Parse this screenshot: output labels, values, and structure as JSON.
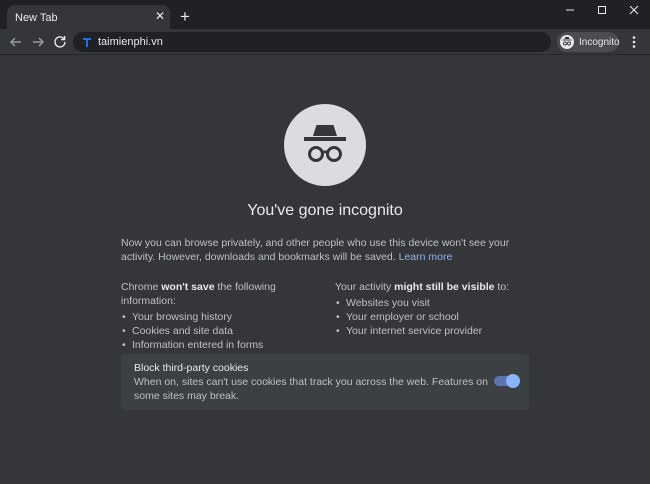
{
  "tab": {
    "title": "New Tab",
    "close_glyph": "✕"
  },
  "new_tab_glyph": "+",
  "window_controls": {
    "minimize": "—",
    "maximize": "☐",
    "close": "✕"
  },
  "toolbar": {
    "back_icon": "back-arrow-icon",
    "forward_icon": "forward-arrow-icon",
    "reload_icon": "reload-icon",
    "url": "taimienphi.vn",
    "profile_label": "Incognito",
    "menu_icon": "kebab-menu-icon"
  },
  "incognito": {
    "headline": "You've gone incognito",
    "intro_text": "Now you can browse privately, and other people who use this device won't see your activity. However, downloads and bookmarks will be saved.",
    "learn_more": "Learn more",
    "left_head_pre": "Chrome ",
    "left_head_bold": "won't save",
    "left_head_post": " the following information:",
    "left_items": [
      "Your browsing history",
      "Cookies and site data",
      "Information entered in forms"
    ],
    "right_head_pre": "Your activity ",
    "right_head_bold": "might still be visible",
    "right_head_post": " to:",
    "right_items": [
      "Websites you visit",
      "Your employer or school",
      "Your internet service provider"
    ],
    "cookies_title": "Block third-party cookies",
    "cookies_desc": "When on, sites can't use cookies that track you across the web. Features on some sites may break.",
    "cookies_toggle_on": true
  },
  "colors": {
    "frame": "#202124",
    "toolbar": "#35363a",
    "accent_link": "#8ab4f8",
    "card": "#3c4043"
  }
}
